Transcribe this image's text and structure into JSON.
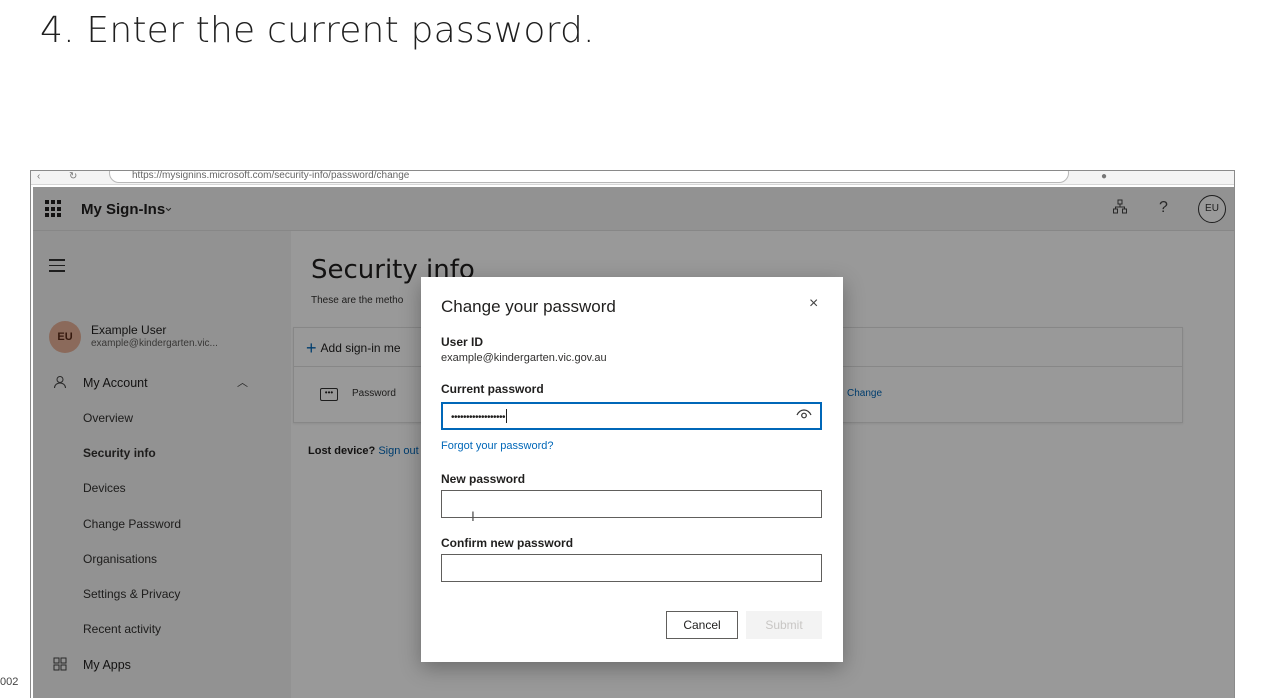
{
  "step": {
    "heading": "4.  Enter the current password."
  },
  "page_number": "002",
  "browser": {
    "url": "https://mysignins.microsoft.com/security-info/password/change"
  },
  "header": {
    "app_name": "My Sign-Ins",
    "help_glyph": "?",
    "avatar_initials": "EU"
  },
  "sidebar": {
    "user": {
      "initials": "EU",
      "name": "Example User",
      "email": "example@kindergarten.vic..."
    },
    "my_account": "My Account",
    "items": [
      {
        "label": "Overview"
      },
      {
        "label": "Security info"
      },
      {
        "label": "Devices"
      },
      {
        "label": "Change Password"
      },
      {
        "label": "Organisations"
      },
      {
        "label": "Settings & Privacy"
      },
      {
        "label": "Recent activity"
      }
    ],
    "my_apps": "My Apps"
  },
  "main": {
    "title": "Security info",
    "subtitle": "These are the metho",
    "add_method": "Add sign-in me",
    "method_label": "Password",
    "change_link": "Change",
    "lost_device_bold": "Lost device?",
    "lost_device_link": "Sign out"
  },
  "dialog": {
    "title": "Change your password",
    "close_glyph": "×",
    "user_id_label": "User ID",
    "user_id_value": "example@kindergarten.vic.gov.au",
    "current_label": "Current password",
    "current_masked": "••••••••••••••••••",
    "forgot_link": "Forgot your password?",
    "new_label": "New password",
    "confirm_label": "Confirm new password",
    "cancel_label": "Cancel",
    "submit_label": "Submit"
  },
  "colors": {
    "accent": "#0067b8",
    "avatar_bg": "#e8b198"
  }
}
